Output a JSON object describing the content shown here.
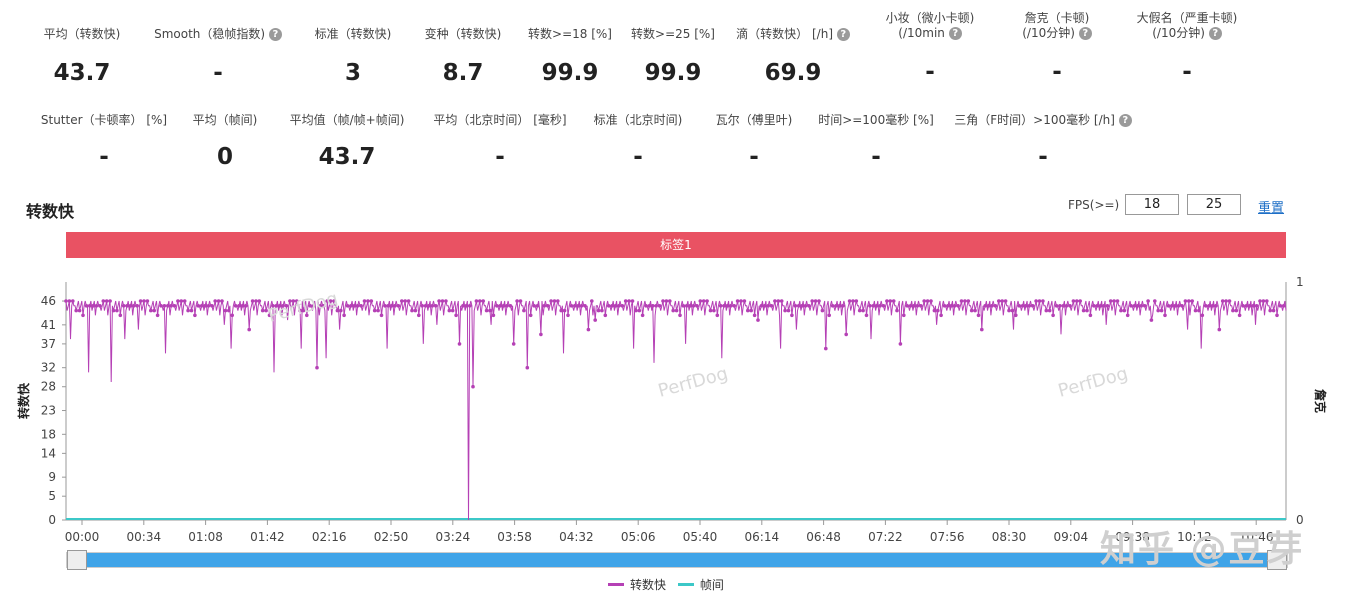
{
  "stats_row1": [
    {
      "label": "平均（转数快)",
      "value": "43.7",
      "help": false
    },
    {
      "label": "Smooth（稳帧指数)",
      "value": "-",
      "help": true
    },
    {
      "label": "标准（转数快)",
      "value": "3",
      "help": false
    },
    {
      "label": "变种（转数快)",
      "value": "8.7",
      "help": false
    },
    {
      "label": "转数>=18 [%]",
      "value": "99.9",
      "help": false
    },
    {
      "label": "转数>=25 [%]",
      "value": "99.9",
      "help": false
    },
    {
      "label": "滴（转数快） [/h]",
      "value": "69.9",
      "help": true
    },
    {
      "label": "小妆（微小卡顿)",
      "label2": "(/10min",
      "value": "-",
      "help": true
    },
    {
      "label": "詹克（卡顿)",
      "label2": "(/10分钟)",
      "value": "-",
      "help": true
    },
    {
      "label": "大假名（严重卡顿)",
      "label2": "(/10分钟)",
      "value": "-",
      "help": true
    }
  ],
  "stats_row2": [
    {
      "label": "Stutter（卡顿率） [%]",
      "value": "-"
    },
    {
      "label": "平均（帧间)",
      "value": "0"
    },
    {
      "label": "平均值（帧/帧+帧间)",
      "value": "43.7"
    },
    {
      "label": "平均（北京时间） [毫秒]",
      "value": "-"
    },
    {
      "label": "标准（北京时间)",
      "value": "-"
    },
    {
      "label": "瓦尔（傅里叶)",
      "value": "-"
    },
    {
      "label": "时间>=100毫秒 [%]",
      "value": "-"
    },
    {
      "label": "三角（F时间）>100毫秒 [/h]",
      "value": "-",
      "help": true
    }
  ],
  "section_title": "转数快",
  "fps_label": "FPS(>=)",
  "fps_values": [
    "18",
    "25"
  ],
  "reset_label": "重置",
  "tag_label": "标签1",
  "watermarks": {
    "brand": "PerfDog",
    "site": "知乎 @豆芽"
  },
  "colors": {
    "fps": "#b540b5",
    "frametime": "#3cc8c8",
    "tag": "#e95263",
    "accent": "#1e6fc7"
  },
  "chart_data": {
    "type": "line",
    "ylabel": "转数快",
    "y2label": "詹克",
    "yticks": [
      0,
      5,
      9,
      14,
      18,
      23,
      28,
      32,
      37,
      41,
      46
    ],
    "y2ticks": [
      0,
      1
    ],
    "ylim": [
      0,
      50
    ],
    "xticks": [
      "00:00",
      "00:34",
      "01:08",
      "01:42",
      "02:16",
      "02:50",
      "03:24",
      "03:58",
      "04:32",
      "05:06",
      "05:40",
      "06:14",
      "06:48",
      "07:22",
      "07:56",
      "08:30",
      "09:04",
      "09:38",
      "10:12",
      "10:46"
    ],
    "x_seconds_max": 660,
    "series": [
      {
        "name": "转数快",
        "baseline": 45,
        "dips": [
          [
            4,
            38
          ],
          [
            20,
            31
          ],
          [
            40,
            29
          ],
          [
            52,
            38
          ],
          [
            64,
            40
          ],
          [
            88,
            35
          ],
          [
            140,
            41
          ],
          [
            146,
            36
          ],
          [
            162,
            40
          ],
          [
            184,
            31
          ],
          [
            196,
            42
          ],
          [
            208,
            36
          ],
          [
            222,
            32
          ],
          [
            230,
            34
          ],
          [
            242,
            40
          ],
          [
            284,
            36
          ],
          [
            316,
            37
          ],
          [
            328,
            41
          ],
          [
            348,
            37
          ],
          [
            356,
            0
          ],
          [
            360,
            28
          ],
          [
            376,
            41
          ],
          [
            396,
            37
          ],
          [
            408,
            32
          ],
          [
            420,
            39
          ],
          [
            440,
            35
          ],
          [
            462,
            40
          ],
          [
            468,
            42
          ],
          [
            502,
            36
          ],
          [
            520,
            33
          ],
          [
            548,
            37
          ],
          [
            580,
            34
          ],
          [
            612,
            42
          ],
          [
            632,
            36
          ],
          [
            646,
            40
          ],
          [
            672,
            36
          ],
          [
            690,
            39
          ],
          [
            712,
            38
          ],
          [
            738,
            37
          ],
          [
            770,
            41
          ],
          [
            810,
            40
          ],
          [
            838,
            40
          ],
          [
            880,
            39
          ],
          [
            920,
            41
          ],
          [
            960,
            42
          ],
          [
            992,
            40
          ],
          [
            1004,
            36
          ],
          [
            1020,
            40
          ],
          [
            1052,
            41
          ]
        ]
      },
      {
        "name": "帧间",
        "values_constant": 0
      }
    ]
  }
}
